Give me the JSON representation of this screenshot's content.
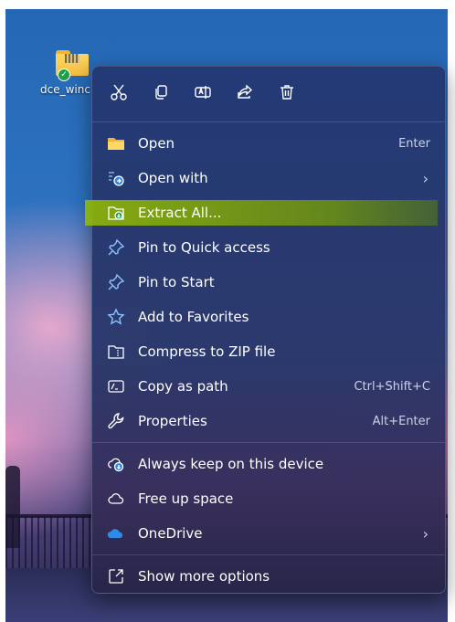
{
  "desktop": {
    "icon_label": "dce_winc"
  },
  "quick_actions": [
    {
      "name": "cut-icon"
    },
    {
      "name": "copy-icon"
    },
    {
      "name": "rename-icon"
    },
    {
      "name": "share-icon"
    },
    {
      "name": "delete-icon"
    }
  ],
  "menu": {
    "open": {
      "label": "Open",
      "shortcut": "Enter"
    },
    "open_with": {
      "label": "Open with",
      "arrow": "›"
    },
    "extract_all": {
      "label": "Extract All..."
    },
    "pin_quick_access": {
      "label": "Pin to Quick access"
    },
    "pin_start": {
      "label": "Pin to Start"
    },
    "add_favorites": {
      "label": "Add to Favorites"
    },
    "compress_zip": {
      "label": "Compress to ZIP file"
    },
    "copy_path": {
      "label": "Copy as path",
      "shortcut": "Ctrl+Shift+C"
    },
    "properties": {
      "label": "Properties",
      "shortcut": "Alt+Enter"
    },
    "always_keep": {
      "label": "Always keep on this device"
    },
    "free_space": {
      "label": "Free up space"
    },
    "onedrive": {
      "label": "OneDrive",
      "arrow": "›"
    },
    "show_more": {
      "label": "Show more options"
    }
  },
  "colors": {
    "highlight": "#8fb800",
    "menu_bg": "#253464",
    "folder": "#f3be3e",
    "onedrive": "#2f8ae6"
  }
}
